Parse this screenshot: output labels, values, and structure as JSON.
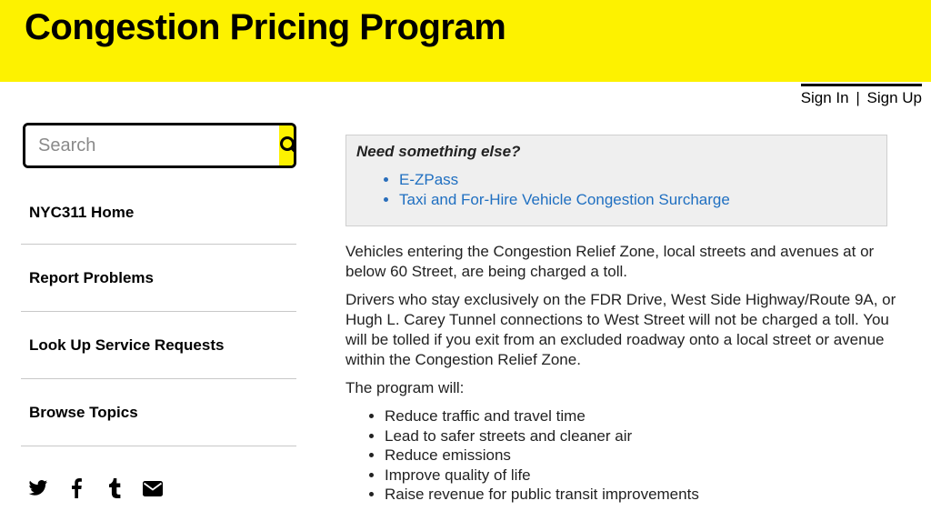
{
  "header": {
    "title": "Congestion Pricing Program"
  },
  "auth": {
    "sign_in": "Sign In",
    "separator": "|",
    "sign_up": "Sign Up"
  },
  "search": {
    "placeholder": "Search",
    "value": "",
    "icon": "search-icon"
  },
  "nav": {
    "items": [
      {
        "label": "NYC311 Home"
      },
      {
        "label": "Report Problems"
      },
      {
        "label": "Look Up Service Requests"
      },
      {
        "label": "Browse Topics"
      }
    ]
  },
  "social": [
    "twitter-icon",
    "facebook-icon",
    "tumblr-icon",
    "email-icon"
  ],
  "callout": {
    "title": "Need something else?",
    "links": [
      "E-ZPass",
      "Taxi and For-Hire Vehicle Congestion Surcharge"
    ]
  },
  "content": {
    "paragraphs": [
      "Vehicles entering the Congestion Relief Zone, local streets and avenues at or below 60 Street, are being charged a toll.",
      "Drivers who stay exclusively on the FDR Drive, West Side Highway/Route 9A, or Hugh L. Carey Tunnel connections to West Street will not be charged a toll. You will be tolled if you exit from an excluded roadway onto a local street or avenue within the Congestion Relief Zone.",
      "The program will:"
    ],
    "bullets": [
      "Reduce traffic and travel time",
      "Lead to safer streets and cleaner air",
      "Reduce emissions",
      "Improve quality of life",
      "Raise revenue for public transit improvements"
    ]
  },
  "colors": {
    "accent": "#fdf200",
    "link": "#1f6fc1"
  }
}
